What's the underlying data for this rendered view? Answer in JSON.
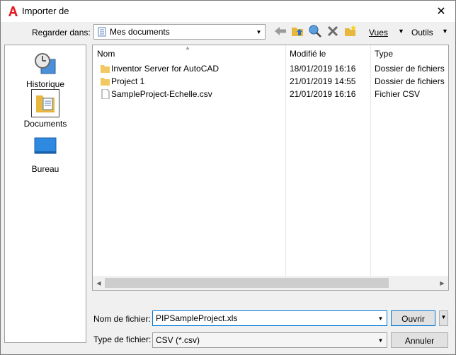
{
  "window": {
    "title": "Importer de",
    "close_glyph": "✕",
    "app_icon": "autocad-a-icon",
    "accent": "#e31b23"
  },
  "toolbar": {
    "look_in_label": "Regarder dans:",
    "look_in_value": "Mes documents",
    "views_label": "Vues",
    "tools_label": "Outils",
    "icons": [
      "back-arrow-icon",
      "up-folder-icon",
      "search-web-icon",
      "delete-icon",
      "new-folder-icon"
    ]
  },
  "places": [
    {
      "label": "Historique",
      "icon": "history-icon"
    },
    {
      "label": "Documents",
      "icon": "documents-icon",
      "selected": true
    },
    {
      "label": "Bureau",
      "icon": "desktop-icon"
    }
  ],
  "file_list": {
    "columns": [
      "Nom",
      "Modifié le",
      "Type"
    ],
    "rows": [
      {
        "name": "Inventor Server for AutoCAD",
        "modified": "18/01/2019 16:16",
        "type": "Dossier de fichiers",
        "icon": "folder-icon"
      },
      {
        "name": "Project 1",
        "modified": "21/01/2019 14:55",
        "type": "Dossier de fichiers",
        "icon": "folder-icon"
      },
      {
        "name": "SampleProject-Echelle.csv",
        "modified": "21/01/2019 16:16",
        "type": "Fichier CSV",
        "icon": "file-icon"
      }
    ]
  },
  "form": {
    "filename_label": "Nom de fichier:",
    "filename_value": "PIPSampleProject.xls",
    "filetype_label": "Type de fichier:",
    "filetype_value": "CSV (*.csv)",
    "open_label": "Ouvrir",
    "cancel_label": "Annuler"
  }
}
